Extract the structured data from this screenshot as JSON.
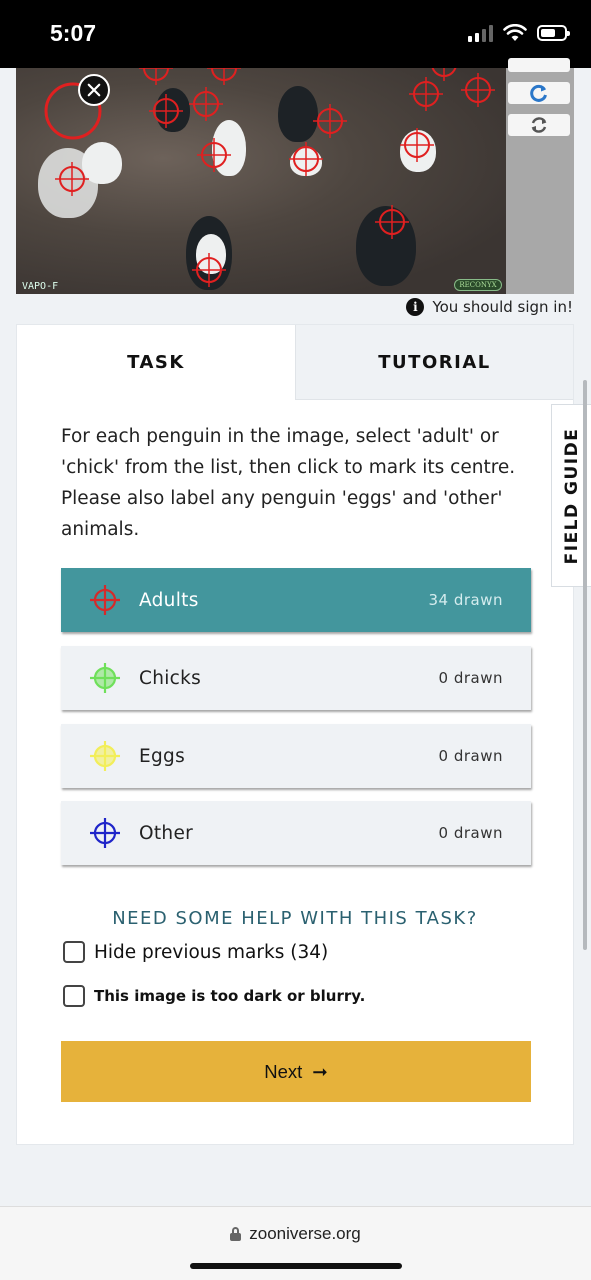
{
  "status_bar": {
    "time": "5:07"
  },
  "subject": {
    "camera_label": "VAPO-F",
    "camera_brand": "RECONYX",
    "mark_color": "#e02020"
  },
  "sign_in_note": "You should sign in!",
  "tabs": {
    "task": "TASK",
    "tutorial": "TUTORIAL"
  },
  "instructions": "For each penguin in the image, select 'adult' or 'chick' from the list, then click to mark its centre. Please also label any penguin 'eggs' and 'other' animals.",
  "answers": [
    {
      "label": "Adults",
      "count": "34 drawn",
      "color": "#d42a2a",
      "selected": true
    },
    {
      "label": "Chicks",
      "count": "0 drawn",
      "color": "#6fe05a",
      "selected": false
    },
    {
      "label": "Eggs",
      "count": "0 drawn",
      "color": "#f2ee5a",
      "selected": false
    },
    {
      "label": "Other",
      "count": "0 drawn",
      "color": "#1f25c9",
      "selected": false
    }
  ],
  "help_link": "NEED SOME HELP WITH THIS TASK?",
  "checkboxes": {
    "hide_marks": "Hide previous marks (34)",
    "too_dark": "This image is too dark or blurry."
  },
  "next_button": {
    "label": "Next",
    "arrow": "➞"
  },
  "field_guide": "FIELD GUIDE",
  "browser": {
    "url": "zooniverse.org"
  },
  "colors": {
    "accent": "#43969d",
    "next": "#e6b23b",
    "help": "#2b6170"
  }
}
